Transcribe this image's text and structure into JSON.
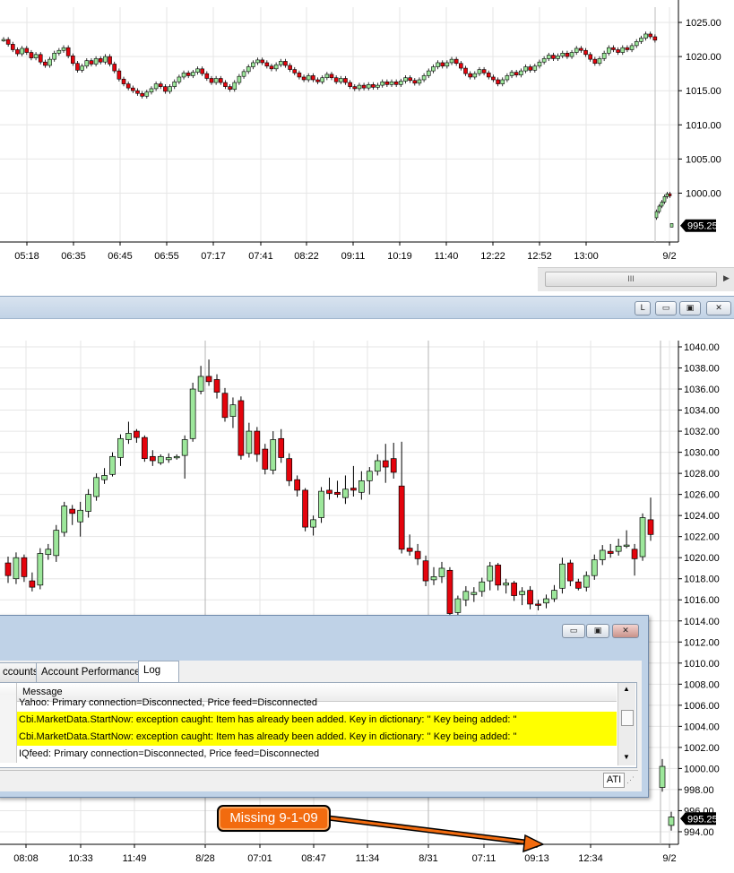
{
  "colors": {
    "up": "#9de79b",
    "down": "#e4040d",
    "grid": "#e6e6e6",
    "axis": "#000000",
    "callout": "#f26b0f",
    "highlight": "#ffff00"
  },
  "top_chart": {
    "chart_data": {
      "type": "candlestick",
      "x_ticks": [
        "05:18",
        "06:35",
        "06:45",
        "06:55",
        "07:17",
        "07:41",
        "08:22",
        "09:11",
        "10:19",
        "11:40",
        "12:22",
        "12:52",
        "13:00",
        "9/2"
      ],
      "y_ticks": [
        "1025.00",
        "1020.00",
        "1015.00",
        "1010.00",
        "1005.00",
        "1000.00"
      ],
      "ylim": [
        995.0,
        1027.0
      ],
      "last_price": "995.25",
      "series_closes": [
        1022.5,
        1021.8,
        1021.0,
        1020.4,
        1021.2,
        1020.6,
        1019.8,
        1020.3,
        1019.2,
        1018.7,
        1019.6,
        1020.5,
        1020.9,
        1021.3,
        1020.1,
        1019.0,
        1018.0,
        1018.6,
        1019.4,
        1018.9,
        1019.7,
        1019.2,
        1020.0,
        1018.9,
        1017.9,
        1016.7,
        1016.0,
        1015.4,
        1015.0,
        1014.6,
        1014.2,
        1014.8,
        1015.3,
        1016.0,
        1015.6,
        1014.9,
        1015.6,
        1016.3,
        1017.0,
        1017.6,
        1017.2,
        1017.7,
        1018.2,
        1017.5,
        1016.8,
        1016.2,
        1016.8,
        1016.2,
        1015.6,
        1015.2,
        1016.2,
        1017.1,
        1017.8,
        1018.5,
        1019.1,
        1019.5,
        1019.1,
        1018.6,
        1018.2,
        1018.8,
        1019.3,
        1018.7,
        1018.1,
        1017.6,
        1017.0,
        1016.6,
        1017.2,
        1016.6,
        1016.3,
        1016.9,
        1017.4,
        1016.9,
        1016.3,
        1016.8,
        1016.2,
        1015.6,
        1015.3,
        1015.8,
        1015.4,
        1015.9,
        1015.5,
        1015.8,
        1016.3,
        1015.9,
        1016.3,
        1015.9,
        1016.4,
        1016.9,
        1016.5,
        1016.1,
        1016.6,
        1017.2,
        1017.9,
        1018.5,
        1019.1,
        1018.6,
        1019.1,
        1019.6,
        1019.0,
        1018.3,
        1017.5,
        1017.0,
        1017.5,
        1018.1,
        1017.6,
        1017.0,
        1016.6,
        1016.0,
        1016.6,
        1017.2,
        1017.7,
        1017.3,
        1017.9,
        1018.5,
        1018.0,
        1018.6,
        1019.2,
        1019.7,
        1020.2,
        1019.7,
        1020.1,
        1020.5,
        1020.0,
        1020.6,
        1021.2,
        1020.9,
        1020.3,
        1019.6,
        1019.0,
        1019.7,
        1020.5,
        1021.3,
        1021.0,
        1020.6,
        1021.3,
        1021.0,
        1021.6,
        1022.2,
        1022.7,
        1023.3,
        1022.9,
        1022.4
      ],
      "recent_closes": [
        997.3,
        998.1,
        998.7,
        999.5,
        999.9,
        999.6
      ],
      "last_bar": 995.25
    }
  },
  "scrollbar": {
    "thumb_label": "III",
    "arrow": "▶"
  },
  "midbar": {
    "buttons": [
      {
        "name": "link-button",
        "label": "L"
      },
      {
        "name": "minimize-button",
        "label": "▭"
      },
      {
        "name": "maximize-button",
        "label": "▣"
      },
      {
        "name": "close-button",
        "label": "✕"
      }
    ]
  },
  "bottom_chart": {
    "chart_data": {
      "type": "candlestick",
      "x_ticks": [
        "08:08",
        "10:33",
        "11:49",
        "8/28",
        "07:01",
        "08:47",
        "11:34",
        "8/31",
        "07:11",
        "09:13",
        "12:34",
        "9/2"
      ],
      "y_ticks": [
        "1040.00",
        "1038.00",
        "1036.00",
        "1034.00",
        "1032.00",
        "1030.00",
        "1028.00",
        "1026.00",
        "1024.00",
        "1022.00",
        "1020.00",
        "1018.00",
        "1016.00",
        "1014.00",
        "1012.00",
        "1010.00",
        "1008.00",
        "1006.00",
        "1004.00",
        "1002.00",
        "1000.00",
        "998.00",
        "996.00",
        "994.00"
      ],
      "ylim": [
        993.0,
        1040.3
      ],
      "last_price": "995.25",
      "bars": [
        [
          1019.5,
          1018.3,
          1020.1,
          1017.6
        ],
        [
          1018.0,
          1020.0,
          1020.5,
          1017.5
        ],
        [
          1020.0,
          1018.2,
          1020.3,
          1017.7
        ],
        [
          1017.8,
          1017.2,
          1018.6,
          1016.8
        ],
        [
          1017.4,
          1020.4,
          1020.9,
          1017.0
        ],
        [
          1020.3,
          1020.8,
          1021.3,
          1019.8
        ],
        [
          1020.2,
          1022.6,
          1023.1,
          1019.6
        ],
        [
          1022.4,
          1024.9,
          1025.3,
          1022.0
        ],
        [
          1024.6,
          1024.2,
          1025.0,
          1023.1
        ],
        [
          1023.4,
          1024.5,
          1025.3,
          1022.0
        ],
        [
          1024.4,
          1026.0,
          1026.5,
          1023.8
        ],
        [
          1025.8,
          1027.6,
          1028.0,
          1025.4
        ],
        [
          1027.4,
          1027.8,
          1028.5,
          1027.0
        ],
        [
          1027.9,
          1029.6,
          1030.0,
          1027.7
        ],
        [
          1029.5,
          1031.3,
          1031.7,
          1028.7
        ],
        [
          1031.2,
          1031.8,
          1032.9,
          1030.8
        ],
        [
          1032.0,
          1031.4,
          1032.2,
          1030.9
        ],
        [
          1031.4,
          1029.4,
          1031.6,
          1029.1
        ],
        [
          1029.6,
          1029.2,
          1030.2,
          1028.7
        ],
        [
          1029.0,
          1029.6,
          1029.8,
          1028.8
        ],
        [
          1029.3,
          1029.5,
          1029.9,
          1029.0
        ],
        [
          1029.5,
          1029.6,
          1029.8,
          1029.3
        ],
        [
          1029.7,
          1031.2,
          1031.6,
          1027.5
        ],
        [
          1031.3,
          1036.0,
          1036.6,
          1031.0
        ],
        [
          1035.8,
          1037.2,
          1038.2,
          1035.5
        ],
        [
          1037.2,
          1036.7,
          1038.8,
          1036.3
        ],
        [
          1036.9,
          1035.7,
          1037.4,
          1035.1
        ],
        [
          1035.6,
          1033.3,
          1036.1,
          1032.9
        ],
        [
          1033.4,
          1034.5,
          1035.2,
          1032.3
        ],
        [
          1034.9,
          1029.7,
          1035.3,
          1029.3
        ],
        [
          1029.9,
          1032.0,
          1032.8,
          1029.5
        ],
        [
          1032.0,
          1029.8,
          1032.4,
          1029.1
        ],
        [
          1030.3,
          1028.4,
          1030.8,
          1027.9
        ],
        [
          1028.3,
          1031.2,
          1032.0,
          1027.9
        ],
        [
          1031.3,
          1029.5,
          1032.2,
          1029.0
        ],
        [
          1029.4,
          1027.3,
          1029.9,
          1026.8
        ],
        [
          1027.4,
          1026.4,
          1027.8,
          1025.8
        ],
        [
          1026.4,
          1022.9,
          1026.6,
          1022.5
        ],
        [
          1022.9,
          1023.6,
          1024.0,
          1022.1
        ],
        [
          1023.8,
          1026.3,
          1026.7,
          1023.3
        ],
        [
          1026.4,
          1026.1,
          1027.6,
          1025.5
        ],
        [
          1026.2,
          1026.0,
          1027.3,
          1025.7
        ],
        [
          1025.7,
          1026.5,
          1027.8,
          1025.1
        ],
        [
          1026.6,
          1026.4,
          1028.7,
          1025.8
        ],
        [
          1026.2,
          1027.3,
          1028.2,
          1025.5
        ],
        [
          1027.3,
          1028.2,
          1028.6,
          1026.0
        ],
        [
          1028.2,
          1029.2,
          1029.8,
          1027.8
        ],
        [
          1029.2,
          1028.6,
          1030.8,
          1027.1
        ],
        [
          1029.4,
          1028.1,
          1030.9,
          1027.5
        ],
        [
          1026.8,
          1020.8,
          1031.0,
          1020.4
        ],
        [
          1020.9,
          1020.6,
          1022.2,
          1020.2
        ],
        [
          1020.6,
          1019.9,
          1021.3,
          1019.3
        ],
        [
          1019.7,
          1017.8,
          1020.2,
          1017.3
        ],
        [
          1017.9,
          1018.2,
          1019.1,
          1017.4
        ],
        [
          1018.2,
          1019.0,
          1019.6,
          1017.6
        ],
        [
          1018.8,
          1014.7,
          1019.1,
          1014.3
        ],
        [
          1014.8,
          1016.1,
          1016.4,
          1014.3
        ],
        [
          1016.0,
          1016.8,
          1017.3,
          1015.4
        ],
        [
          1016.5,
          1016.7,
          1017.2,
          1015.8
        ],
        [
          1016.8,
          1017.7,
          1018.1,
          1016.3
        ],
        [
          1017.8,
          1019.2,
          1019.6,
          1016.9
        ],
        [
          1019.3,
          1017.4,
          1019.5,
          1016.9
        ],
        [
          1017.4,
          1017.6,
          1018.0,
          1016.6
        ],
        [
          1017.6,
          1016.4,
          1017.8,
          1015.9
        ],
        [
          1016.5,
          1016.8,
          1017.2,
          1015.5
        ],
        [
          1016.9,
          1015.6,
          1017.3,
          1015.1
        ],
        [
          1015.6,
          1015.5,
          1016.0,
          1015.0
        ],
        [
          1015.7,
          1016.1,
          1016.5,
          1015.2
        ],
        [
          1016.1,
          1016.9,
          1017.4,
          1015.8
        ],
        [
          1017.1,
          1019.4,
          1020.0,
          1016.6
        ],
        [
          1019.5,
          1017.8,
          1019.8,
          1017.3
        ],
        [
          1017.7,
          1017.1,
          1018.0,
          1016.9
        ],
        [
          1017.2,
          1018.3,
          1018.7,
          1016.8
        ],
        [
          1018.3,
          1019.8,
          1020.3,
          1017.9
        ],
        [
          1019.8,
          1020.7,
          1021.2,
          1019.3
        ],
        [
          1020.6,
          1020.4,
          1021.3,
          1020.0
        ],
        [
          1020.6,
          1021.1,
          1021.8,
          1020.2
        ],
        [
          1021.2,
          1021.2,
          1022.6,
          1020.9
        ],
        [
          1020.8,
          1019.9,
          1021.3,
          1018.3
        ],
        [
          1020.1,
          1023.8,
          1024.2,
          1019.7
        ],
        [
          1023.6,
          1022.2,
          1025.7,
          1021.6
        ],
        [
          998.2,
          1000.2,
          1000.9,
          997.8
        ],
        [
          994.6,
          995.4,
          995.9,
          994.1
        ]
      ]
    }
  },
  "log_window": {
    "title_buttons": [
      {
        "name": "log-minimize-button",
        "label": "▭"
      },
      {
        "name": "log-maximize-button",
        "label": "▣"
      },
      {
        "name": "log-close-button",
        "label": "✕"
      }
    ],
    "tabs": [
      "ccounts",
      "Account Performance",
      "Log"
    ],
    "active_tab": "Log",
    "column_header": "Message",
    "rows": [
      {
        "text": "Yahoo: Primary connection=Disconnected, Price feed=Disconnected",
        "highlight": false
      },
      {
        "text": "Cbi.MarketData.StartNow: exception caught: Item has already been added. Key in dictionary: ''  Key being added: ''",
        "highlight": true
      },
      {
        "text": "Cbi.MarketData.StartNow: exception caught: Item has already been added. Key in dictionary: ''  Key being added: ''",
        "highlight": true
      },
      {
        "text": "IQfeed: Primary connection=Disconnected, Price feed=Disconnected",
        "highlight": false
      }
    ],
    "status_label": "ATI"
  },
  "annotation": {
    "callout_text": "Missing 9-1-09"
  }
}
